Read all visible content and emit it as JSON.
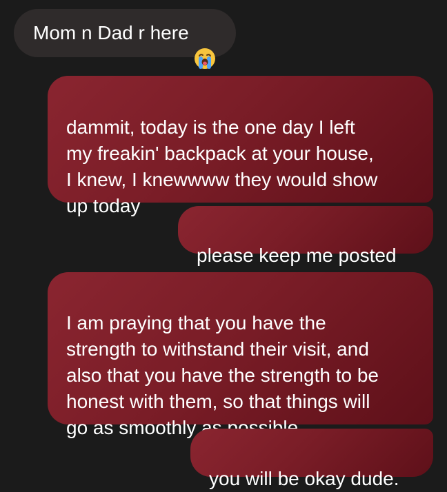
{
  "thread": {
    "incoming": [
      {
        "text": "Mom n Dad r here",
        "emoji": "loudly-crying-face-icon"
      }
    ],
    "outgoing": [
      {
        "text": "dammit, today is the one day I left\nmy freakin' backpack at your house,\nI knew, I knewwww they would show\nup today"
      },
      {
        "text": "please keep me posted"
      },
      {
        "text": "I am praying that you have the\nstrength to withstand their visit, and\nalso that you have the strength to be\nhonest with them, so that things will\ngo as smoothly as possible."
      },
      {
        "text": "you will be okay dude."
      }
    ]
  },
  "colors": {
    "background": "#1b1b1b",
    "incoming_bubble": "#2f2b2b",
    "outgoing_bubble": "#7a1d27",
    "text": "#ffffff"
  }
}
